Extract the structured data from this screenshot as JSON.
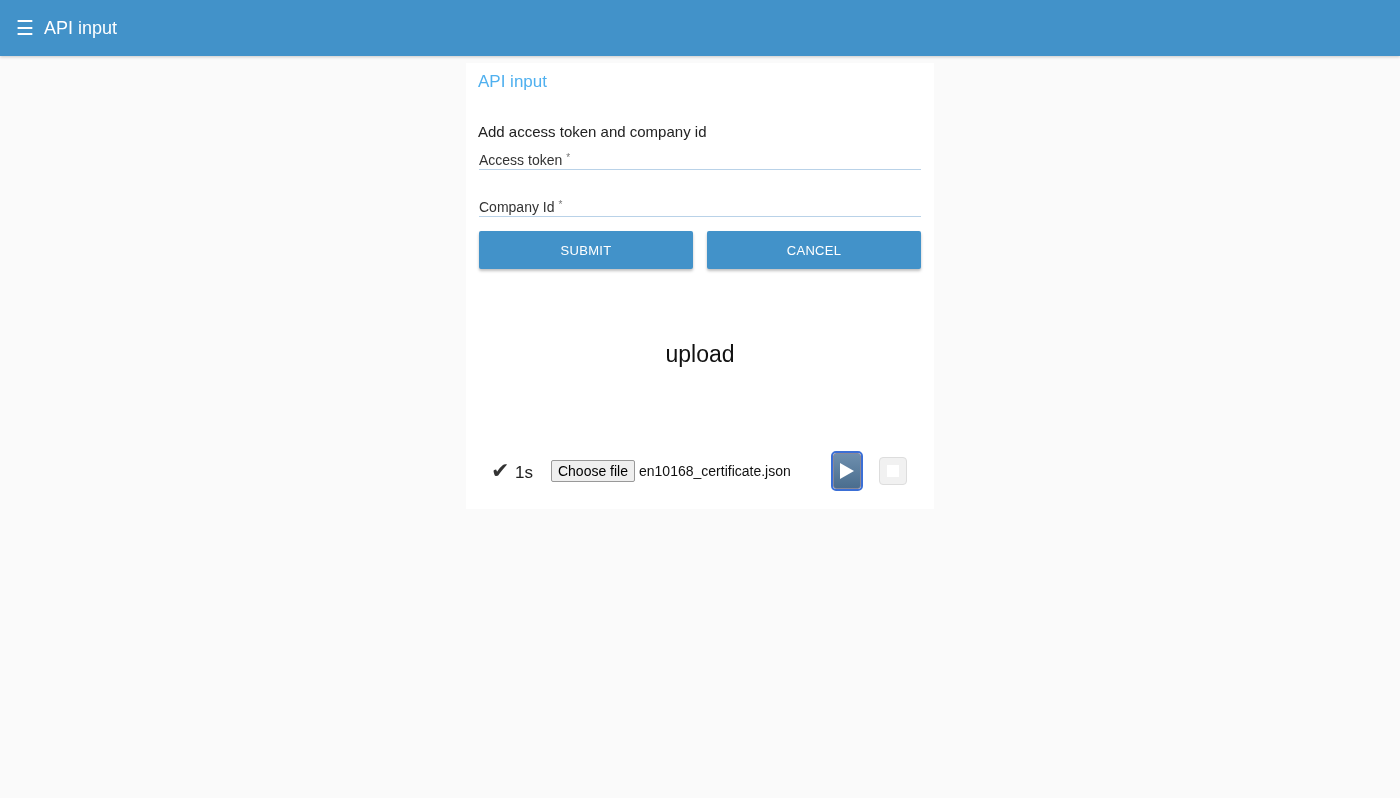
{
  "app_bar": {
    "menu_icon": "☰",
    "title": "API input"
  },
  "card": {
    "title": "API input",
    "heading": "Add access token and company id",
    "fields": [
      {
        "label": "Access token",
        "required_mark": "*"
      },
      {
        "label": "Company Id",
        "required_mark": "*"
      }
    ],
    "buttons": [
      "SUBMIT",
      "CANCEL"
    ]
  },
  "upload": {
    "title": "upload",
    "status_mark": "✔",
    "elapsed": "1s",
    "choose_button": "Choose file",
    "file_name": "en10168_certificate.json",
    "play_button": {
      "focused": true
    },
    "stop_button": {
      "disabled": true
    }
  }
}
